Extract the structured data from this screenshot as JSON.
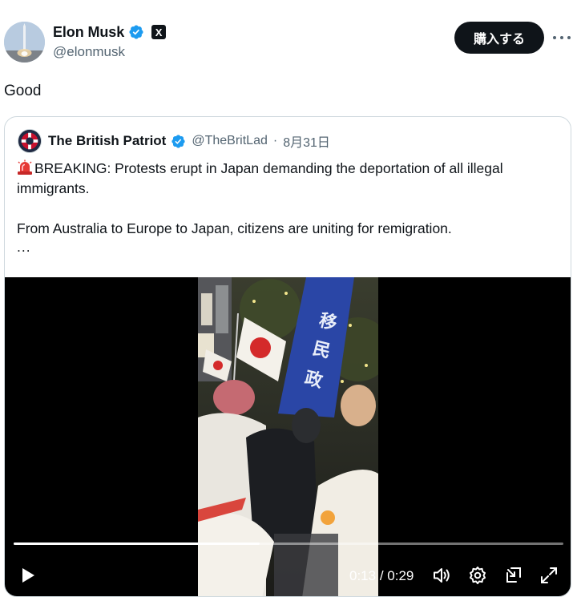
{
  "author": {
    "name": "Elon Musk",
    "handle": "@elonmusk",
    "affiliate_badge": "X",
    "verified_color": "#1d9bf0"
  },
  "actions": {
    "subscribe_label": "購入する",
    "more_icon": "more-horizontal-icon"
  },
  "tweet": {
    "text": "Good"
  },
  "quoted": {
    "name": "The British Patriot",
    "handle": "@TheBritLad",
    "separator": "·",
    "date": "8月31日",
    "paragraph1": "BREAKING: Protests erupt in Japan demanding the deportation of all illegal immigrants.",
    "paragraph2": "From Australia to Europe to Japan, citizens are uniting for remigration.",
    "ellipsis": "...",
    "leading_icon": "rotating-light-emoji-icon"
  },
  "player": {
    "current_time": "0:13",
    "time_separator": "/",
    "duration": "0:29",
    "progress": 0.448,
    "icons": [
      "play-icon",
      "volume-icon",
      "settings-icon",
      "picture-in-picture-icon",
      "fullscreen-icon"
    ]
  }
}
